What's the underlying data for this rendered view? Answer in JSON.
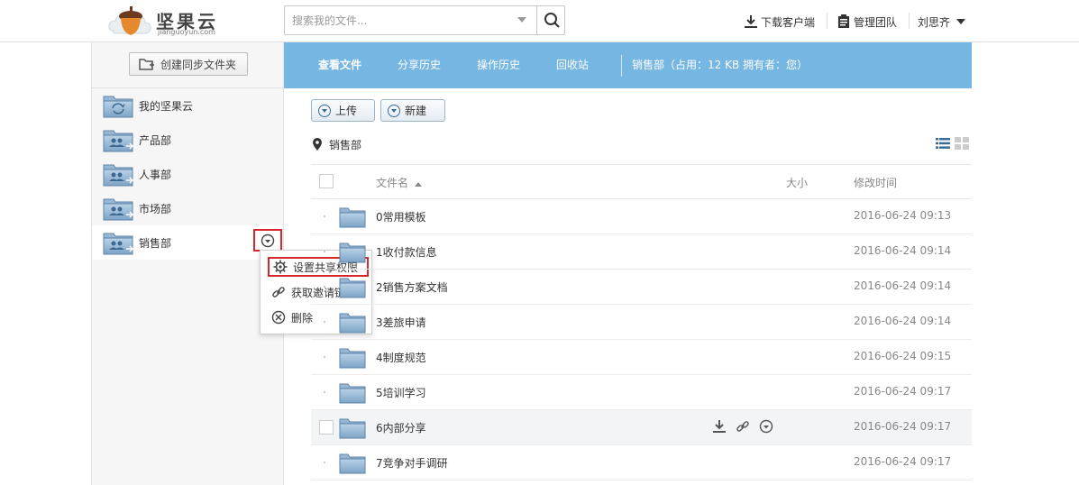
{
  "header": {
    "logo_text": "坚果云",
    "logo_sub": "jianguoyun.com",
    "search_placeholder": "搜索我的文件...",
    "download_client": "下载客户端",
    "manage_team": "管理团队",
    "user_name": "刘思齐"
  },
  "sidebar": {
    "create_sync_label": "创建同步文件夹",
    "items": [
      {
        "label": "我的坚果云"
      },
      {
        "label": "产品部"
      },
      {
        "label": "人事部"
      },
      {
        "label": "市场部"
      },
      {
        "label": "销售部"
      }
    ]
  },
  "context_menu": {
    "items": [
      {
        "label": "设置共享权限"
      },
      {
        "label": "获取邀请链接"
      },
      {
        "label": "删除"
      }
    ]
  },
  "tabs": [
    {
      "label": "查看文件"
    },
    {
      "label": "分享历史"
    },
    {
      "label": "操作历史"
    },
    {
      "label": "回收站"
    }
  ],
  "folder_info": "销售部（占用：12 KB   拥有者：您）",
  "buttons": {
    "upload": "上传",
    "new": "新建"
  },
  "breadcrumb": "销售部",
  "table": {
    "col_name": "文件名",
    "col_size": "大小",
    "col_modified": "修改时间",
    "rows": [
      {
        "name": "0常用模板",
        "modified": "2016-06-24 09:13"
      },
      {
        "name": "1收付款信息",
        "modified": "2016-06-24 09:14"
      },
      {
        "name": "2销售方案文档",
        "modified": "2016-06-24 09:14"
      },
      {
        "name": "3差旅申请",
        "modified": "2016-06-24 09:14"
      },
      {
        "name": "4制度规范",
        "modified": "2016-06-24 09:15"
      },
      {
        "name": "5培训学习",
        "modified": "2016-06-24 09:17"
      },
      {
        "name": "6内部分享",
        "modified": "2016-06-24 09:17"
      },
      {
        "name": "7竞争对手调研",
        "modified": "2016-06-24 09:17"
      }
    ]
  },
  "colors": {
    "tab_bar": "#76b6e3",
    "highlight_box": "#d9262b",
    "folder_blue": "#7fa8cc"
  }
}
